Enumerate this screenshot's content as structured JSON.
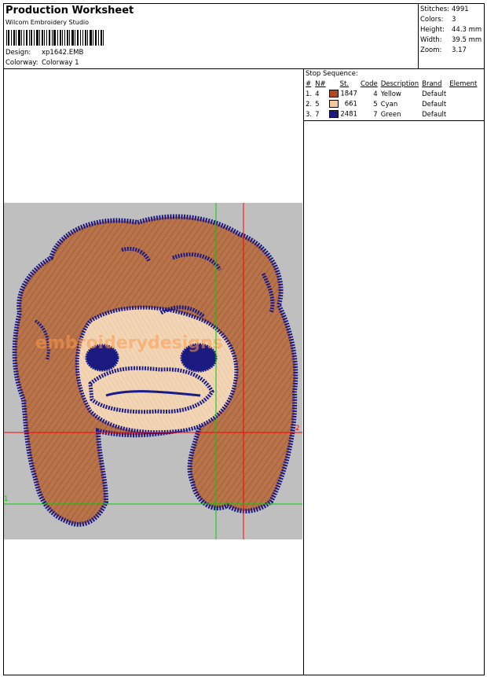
{
  "header": {
    "title": "Production Worksheet",
    "software": "Wilcom Embroidery Studio",
    "design_label": "Design:",
    "design_value": "xp1642.EMB",
    "colorway_label": "Colorway:",
    "colorway_value": "Colorway 1"
  },
  "stats": [
    {
      "label": "Stitches:",
      "value": "4991"
    },
    {
      "label": "Colors:",
      "value": "3"
    },
    {
      "label": "Height:",
      "value": "44.3 mm"
    },
    {
      "label": "Width:",
      "value": "39.5 mm"
    },
    {
      "label": "Zoom:",
      "value": "3.17"
    }
  ],
  "stop_sequence": {
    "title": "Stop Sequence:",
    "headers": [
      "#",
      "N#",
      "St.",
      "Code",
      "Description",
      "Brand",
      "Element"
    ],
    "rows": [
      {
        "num": "1.",
        "n": "4",
        "color": "#b04a1c",
        "st": "1847",
        "code": "4",
        "desc": "Yellow",
        "brand": "Default",
        "element": ""
      },
      {
        "num": "2.",
        "n": "5",
        "color": "#f5c79a",
        "st": "661",
        "code": "5",
        "desc": "Cyan",
        "brand": "Default",
        "element": ""
      },
      {
        "num": "3.",
        "n": "7",
        "color": "#1a1a80",
        "st": "2481",
        "code": "7",
        "desc": "Green",
        "brand": "Default",
        "element": ""
      }
    ]
  },
  "preview": {
    "watermark": "embroiderydesigns",
    "marker_red": "2",
    "marker_green": "1",
    "colors": {
      "hair": "#b8734a",
      "face": "#f1d5b5",
      "outline": "#1a1a8a",
      "bg": "#bfbfbf"
    }
  }
}
